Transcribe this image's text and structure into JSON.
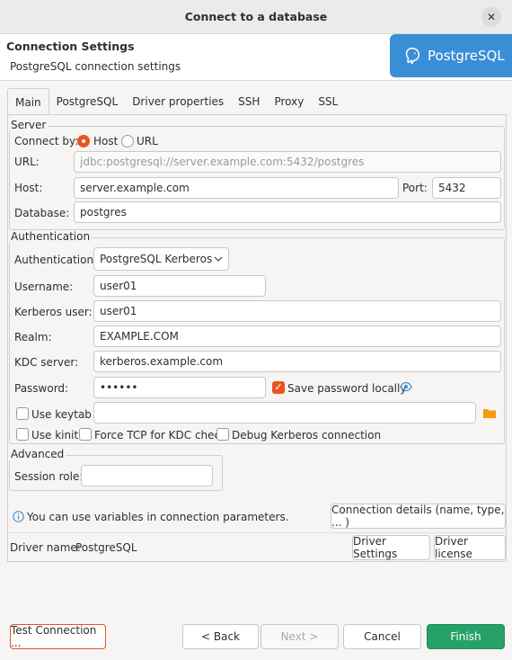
{
  "window": {
    "title": "Connect to a database",
    "close_glyph": "✕"
  },
  "header": {
    "title": "Connection Settings",
    "subtitle": "PostgreSQL connection settings",
    "logo_text": "PostgreSQL"
  },
  "tabs": [
    {
      "label": "Main",
      "active": true
    },
    {
      "label": "PostgreSQL"
    },
    {
      "label": "Driver properties"
    },
    {
      "label": "SSH"
    },
    {
      "label": "Proxy"
    },
    {
      "label": "SSL"
    }
  ],
  "server": {
    "group_label": "Server",
    "connect_by_label": "Connect by:",
    "host_option": "Host",
    "url_option": "URL",
    "url_label": "URL:",
    "url_value": "jdbc:postgresql://server.example.com:5432/postgres",
    "host_label": "Host:",
    "host_value": "server.example.com",
    "port_label": "Port:",
    "port_value": "5432",
    "database_label": "Database:",
    "database_value": "postgres"
  },
  "auth": {
    "group_label": "Authentication",
    "auth_label": "Authentication:",
    "auth_value": "PostgreSQL Kerberos",
    "username_label": "Username:",
    "username_value": "user01",
    "kerberos_user_label": "Kerberos user:",
    "kerberos_user_value": "user01",
    "realm_label": "Realm:",
    "realm_value": "EXAMPLE.COM",
    "kdc_label": "KDC server:",
    "kdc_value": "kerberos.example.com",
    "password_label": "Password:",
    "password_value": "••••••",
    "save_password_label": "Save password locally",
    "use_keytab_label": "Use keytab",
    "use_kinit_label": "Use kinit",
    "force_tcp_label": "Force TCP for KDC check",
    "debug_kerberos_label": "Debug Kerberos connection"
  },
  "advanced": {
    "group_label": "Advanced",
    "session_role_label": "Session role:",
    "session_role_value": ""
  },
  "info": {
    "text": "You can use variables in connection parameters.",
    "details_button": "Connection details (name, type, ... )"
  },
  "driver": {
    "label": "Driver name:",
    "value": "PostgreSQL",
    "settings_button": "Driver Settings",
    "license_button": "Driver license"
  },
  "footer": {
    "test_button": "Test Connection ...",
    "back_button": "< Back",
    "next_button": "Next >",
    "cancel_button": "Cancel",
    "finish_button": "Finish"
  },
  "colors": {
    "accent": "#e95420",
    "finish": "#26a269",
    "logo_bg": "#3a8ed6",
    "eye": "#3a8ed6",
    "folder": "#f59a0c"
  }
}
